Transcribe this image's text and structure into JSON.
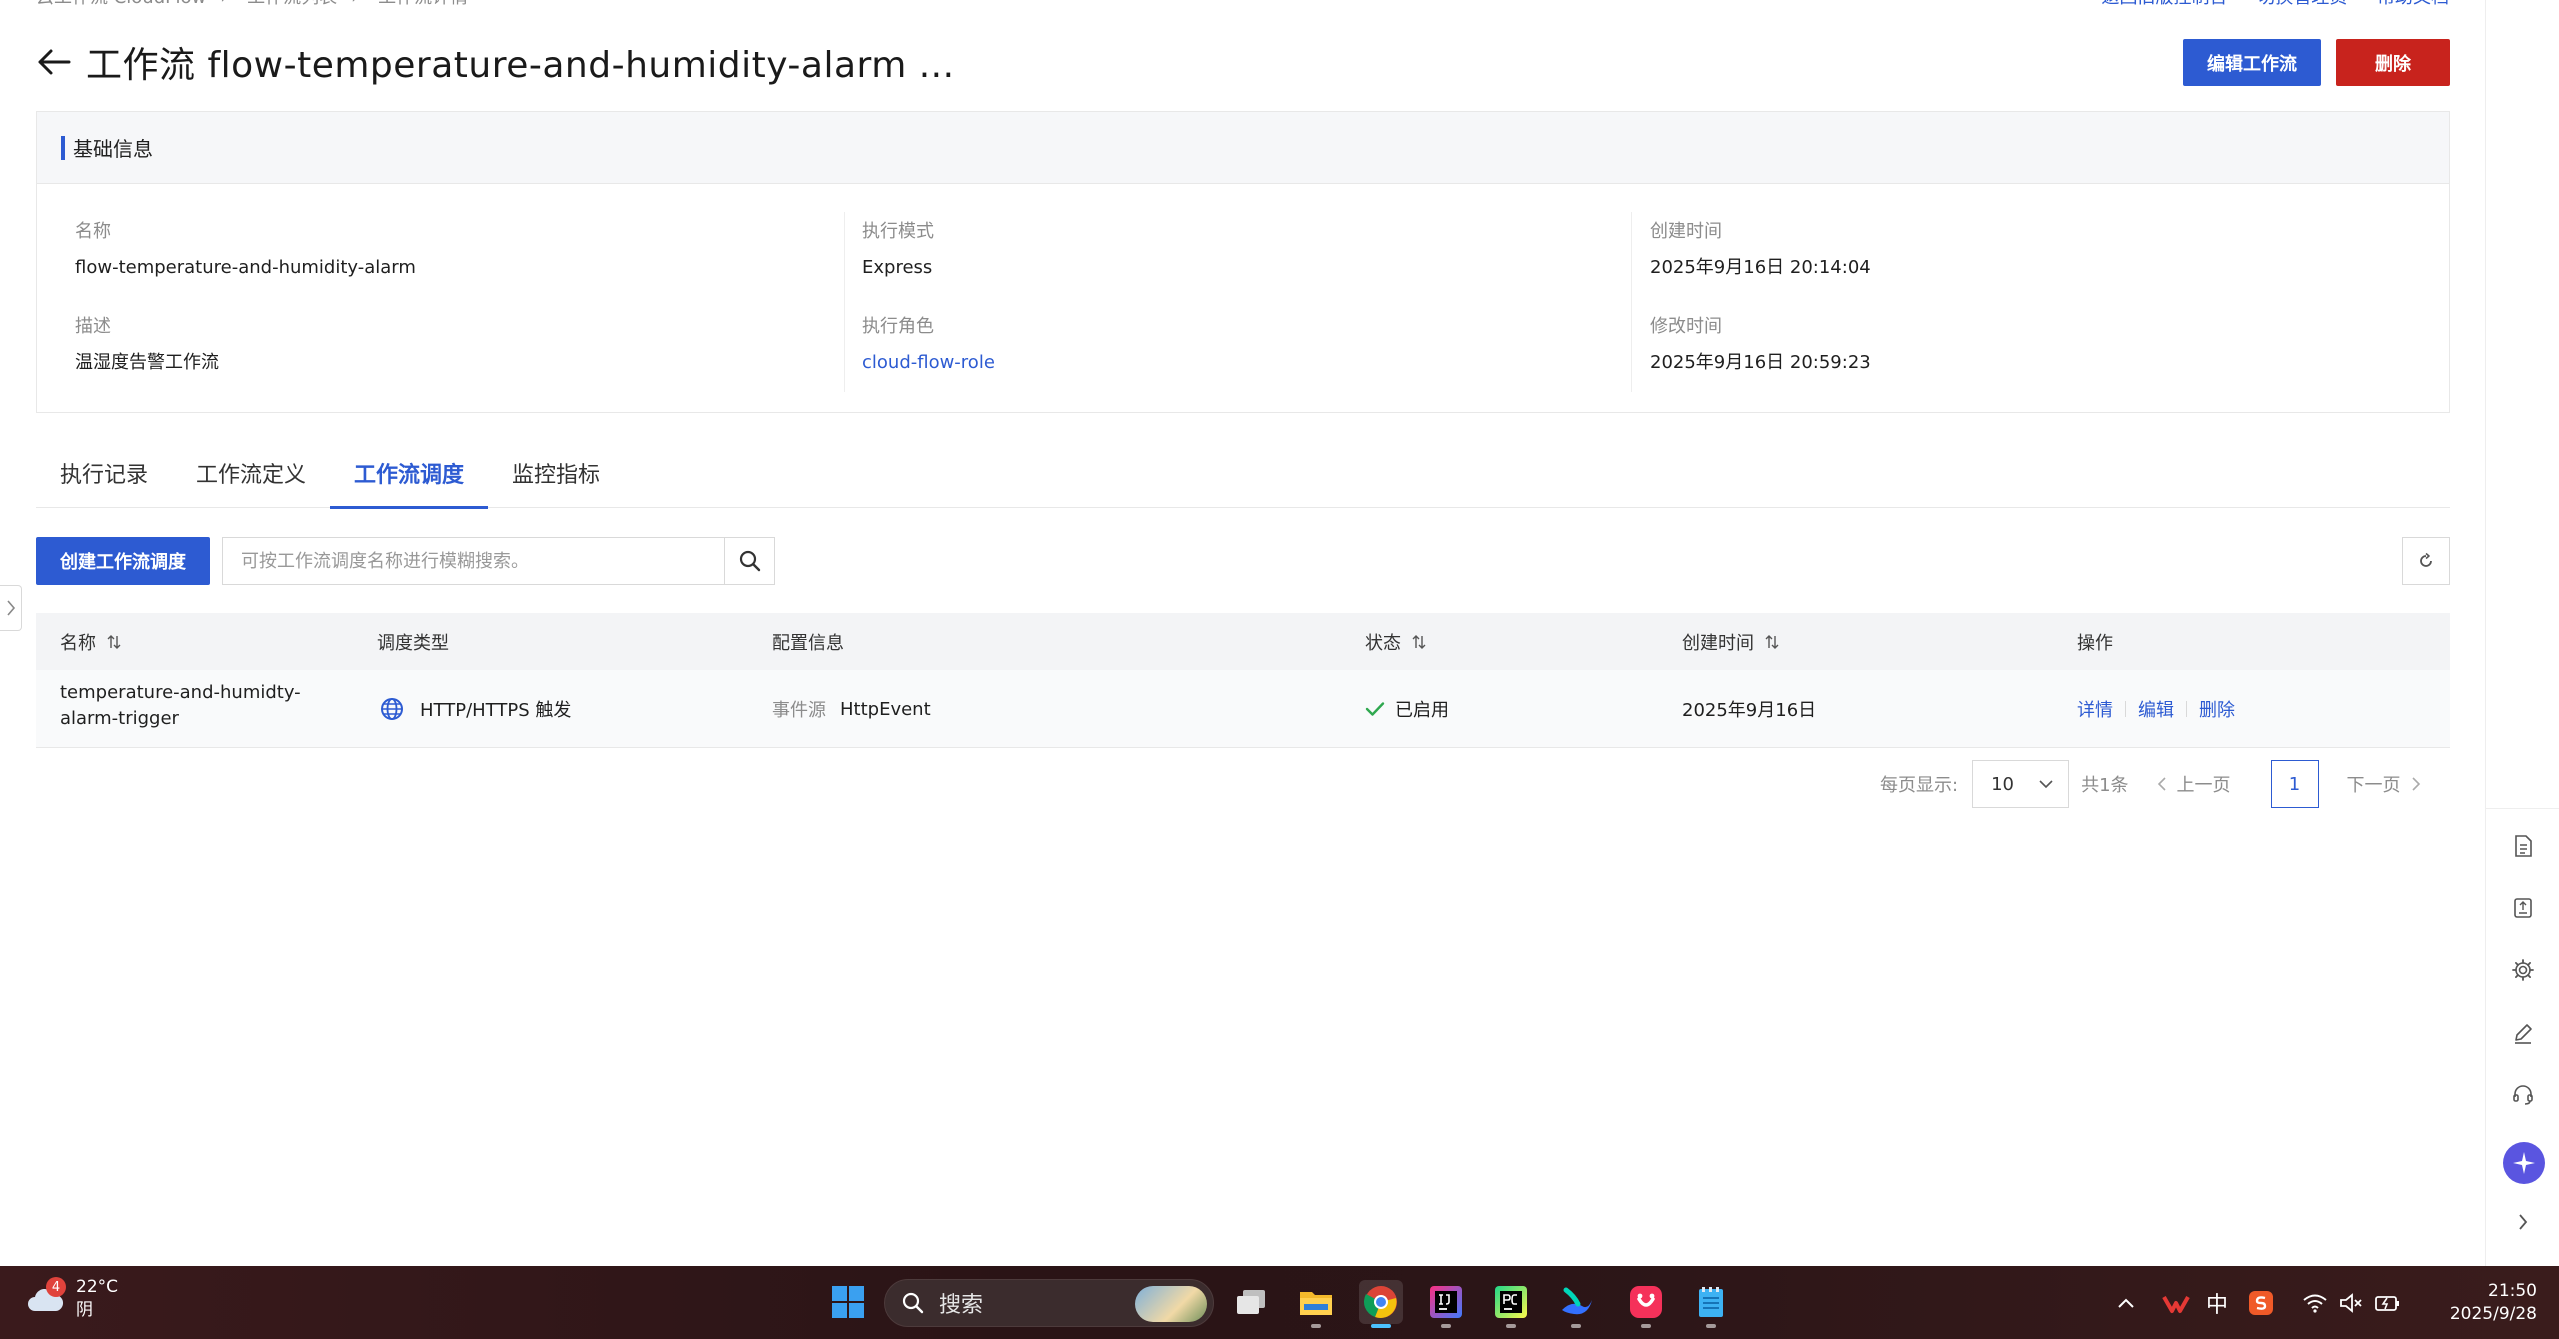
{
  "breadcrumb": [
    "云工作流 CloudFlow",
    "工作流列表",
    "工作流详情"
  ],
  "top_links": [
    "返回旧版控制台",
    "切换管理员",
    "帮助文档"
  ],
  "header": {
    "title": "工作流 flow-temperature-and-humidity-alarm ...",
    "edit_button": "编辑工作流",
    "delete_button": "删除"
  },
  "basic_info": {
    "section_title": "基础信息",
    "name_label": "名称",
    "name_value": "flow-temperature-and-humidity-alarm",
    "desc_label": "描述",
    "desc_value": "温湿度告警工作流",
    "mode_label": "执行模式",
    "mode_value": "Express",
    "role_label": "执行角色",
    "role_value": "cloud-flow-role",
    "created_label": "创建时间",
    "created_value": "2025年9月16日 20:14:04",
    "modified_label": "修改时间",
    "modified_value": "2025年9月16日 20:59:23"
  },
  "tabs": [
    {
      "label": "执行记录"
    },
    {
      "label": "工作流定义"
    },
    {
      "label": "工作流调度",
      "active": true
    },
    {
      "label": "监控指标"
    }
  ],
  "toolbar": {
    "create_button": "创建工作流调度",
    "search_placeholder": "可按工作流调度名称进行模糊搜索。"
  },
  "table": {
    "columns": [
      "名称",
      "调度类型",
      "配置信息",
      "状态",
      "创建时间",
      "操作"
    ],
    "rows": [
      {
        "name": "temperature-and-humidty-alarm-trigger",
        "type": "HTTP/HTTPS 触发",
        "config_key": "事件源",
        "config_value": "HttpEvent",
        "status": "已启用",
        "created": "2025年9月16日",
        "ops": [
          "详情",
          "编辑",
          "删除"
        ]
      }
    ]
  },
  "pagination": {
    "per_page_label": "每页显示:",
    "page_size": "10",
    "total": "共1条",
    "prev": "上一页",
    "current": "1",
    "next": "下一页"
  },
  "taskbar": {
    "weather_temp": "22°C",
    "weather_desc": "阴",
    "weather_badge": "4",
    "search_label": "搜索",
    "ime": "中",
    "time": "21:50",
    "date": "2025/9/28"
  },
  "colors": {
    "primary": "#2d5bd2",
    "danger": "#c8231d",
    "success": "#2fa84f"
  }
}
